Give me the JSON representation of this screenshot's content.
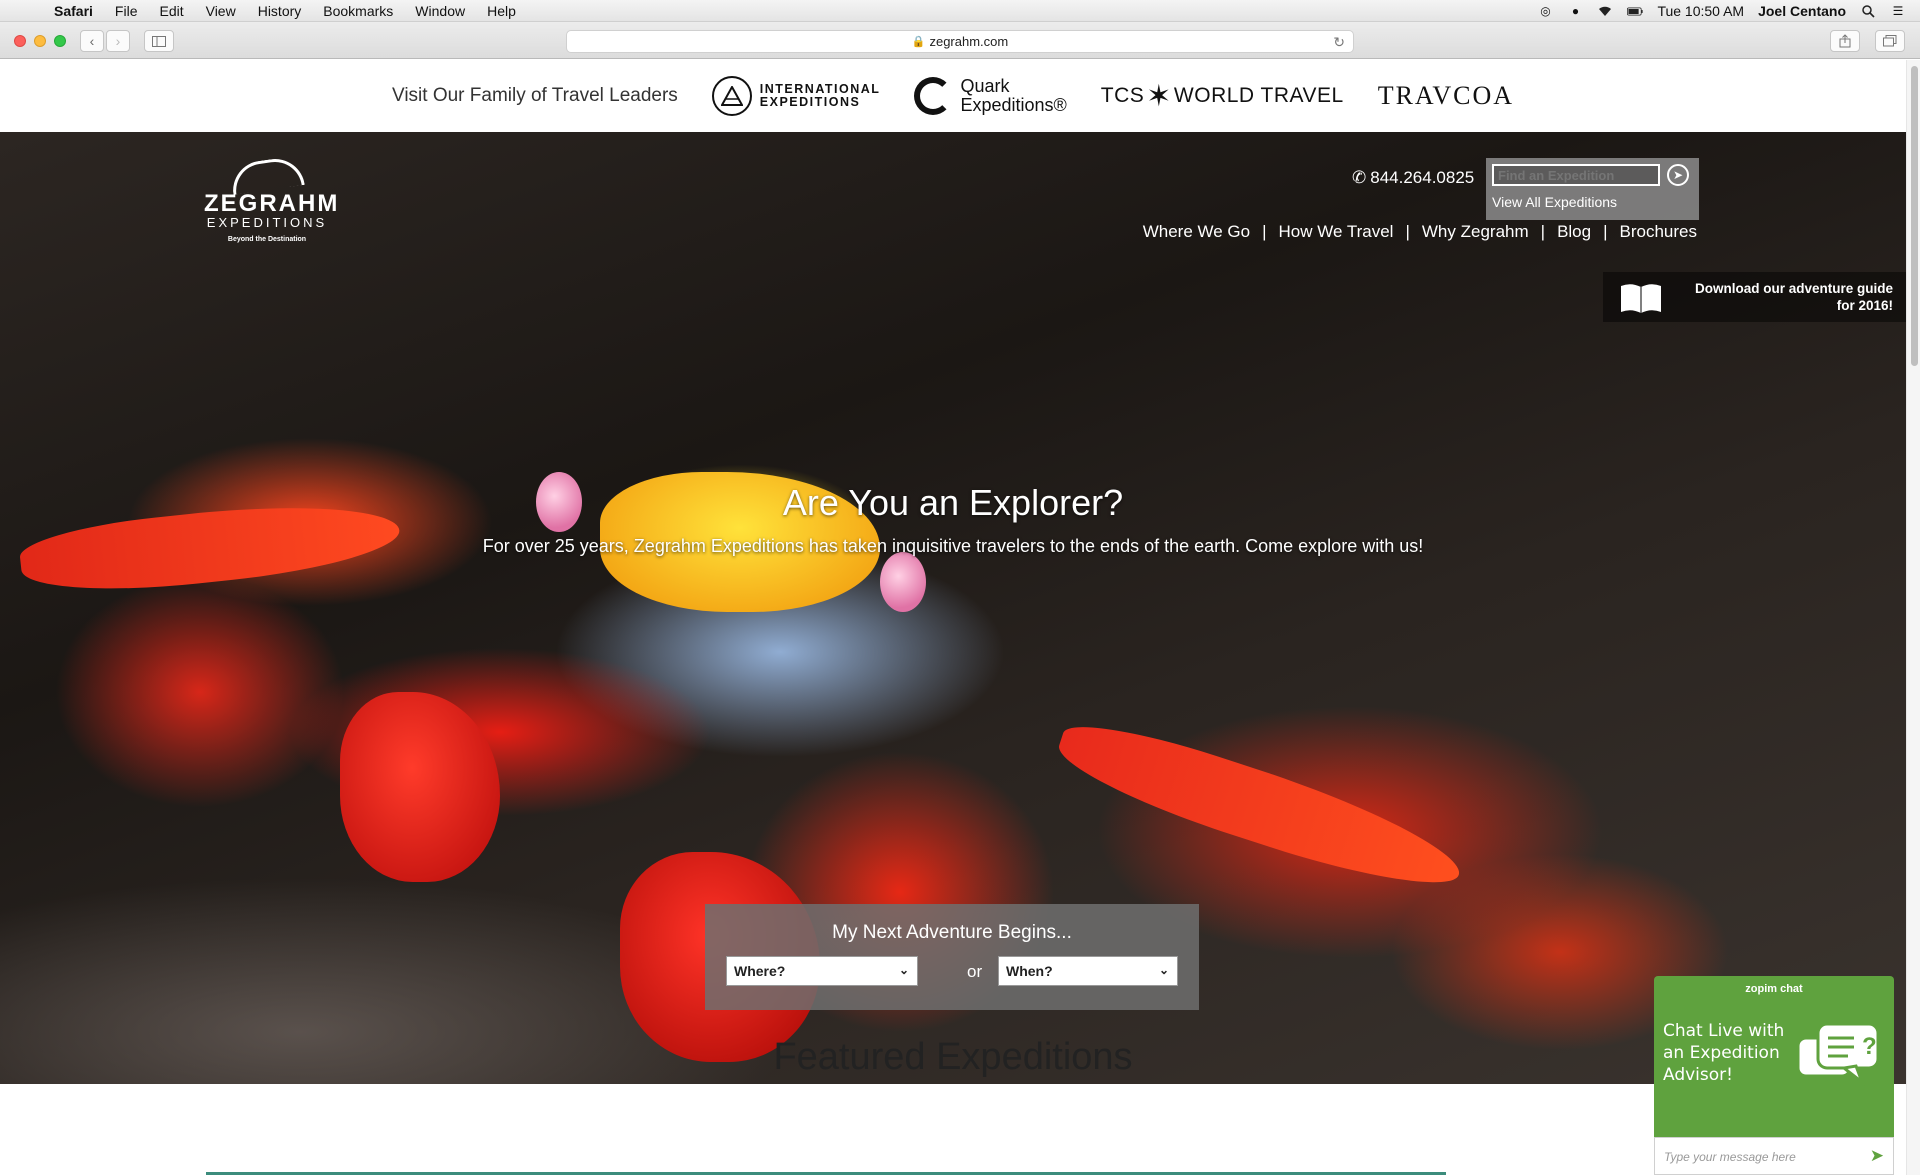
{
  "menubar": {
    "apple": "",
    "app": "Safari",
    "items": [
      "File",
      "Edit",
      "View",
      "History",
      "Bookmarks",
      "Window",
      "Help"
    ],
    "clock": "Tue 10:50 AM",
    "user": "Joel Centano"
  },
  "browser": {
    "url": "zegrahm.com"
  },
  "family": {
    "label": "Visit Our Family of Travel Leaders",
    "brands": {
      "ie_line1": "INTERNATIONAL",
      "ie_line2": "EXPEDITIONS",
      "quark_line1": "Quark",
      "quark_line2": "Expeditions®",
      "tcs_left": "TCS",
      "tcs_right": "WORLD TRAVEL",
      "travcoa": "TRAVCOA"
    }
  },
  "header": {
    "logo_name": "ZEGRAHM",
    "logo_sub": "EXPEDITIONS",
    "logo_tag": "Beyond the Destination",
    "phone": "844.264.0825",
    "find_placeholder": "Find an Expedition",
    "view_all": "View All Expeditions",
    "nav": [
      "Where We Go",
      "How We Travel",
      "Why Zegrahm",
      "Blog",
      "Brochures"
    ],
    "guide_text": "Download our adventure guide for 2016!"
  },
  "hero": {
    "title": "Are You an Explorer?",
    "subtitle": "For over 25 years, Zegrahm Expeditions has taken inquisitive travelers to the ends of the earth. Come explore with us!"
  },
  "adventure": {
    "title": "My Next Adventure Begins...",
    "where": "Where?",
    "or": "or",
    "when": "When?"
  },
  "featured": {
    "title": "Featured Expeditions"
  },
  "chat": {
    "brand": "zopim chat",
    "message": "Chat Live with an Expedition Advisor!",
    "input_placeholder": "Type your message here"
  }
}
